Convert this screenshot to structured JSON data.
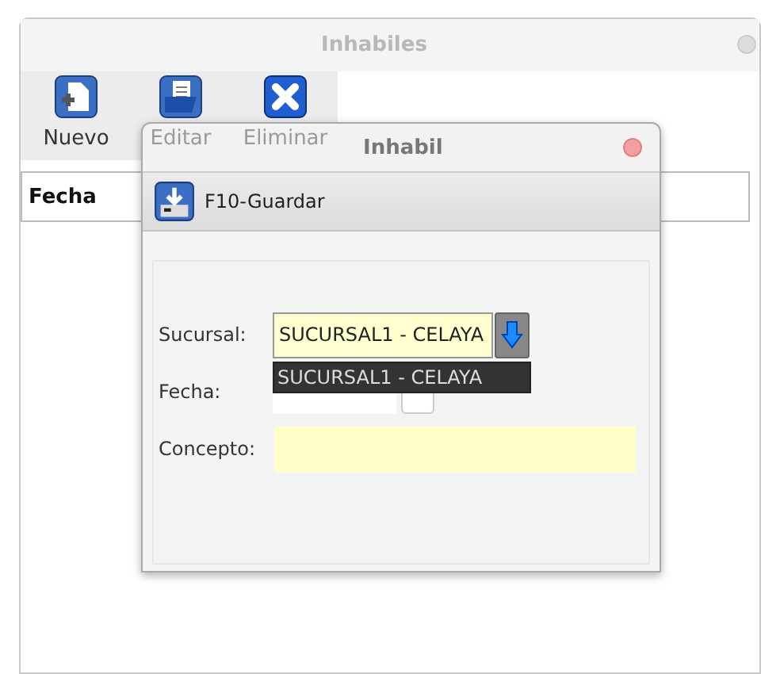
{
  "window": {
    "title": "Inhabiles"
  },
  "toolbar": [
    {
      "label": "Nuevo",
      "kind": "new",
      "disabled": false
    },
    {
      "label": "Editar",
      "kind": "edit",
      "disabled": true
    },
    {
      "label": "Eliminar",
      "kind": "delete",
      "disabled": true
    }
  ],
  "table": {
    "columns": [
      "Fecha"
    ]
  },
  "dialog": {
    "title": "Inhabil",
    "save_button": "F10-Guardar",
    "fields": [
      {
        "label": "Sucursal:",
        "kind": "combo",
        "value": "SUCURSAL1 - CELAYA",
        "options": [
          "SUCURSAL1 - CELAYA"
        ]
      },
      {
        "label": "Fecha:",
        "kind": "date"
      },
      {
        "label": "Concepto:",
        "kind": "text"
      }
    ]
  }
}
